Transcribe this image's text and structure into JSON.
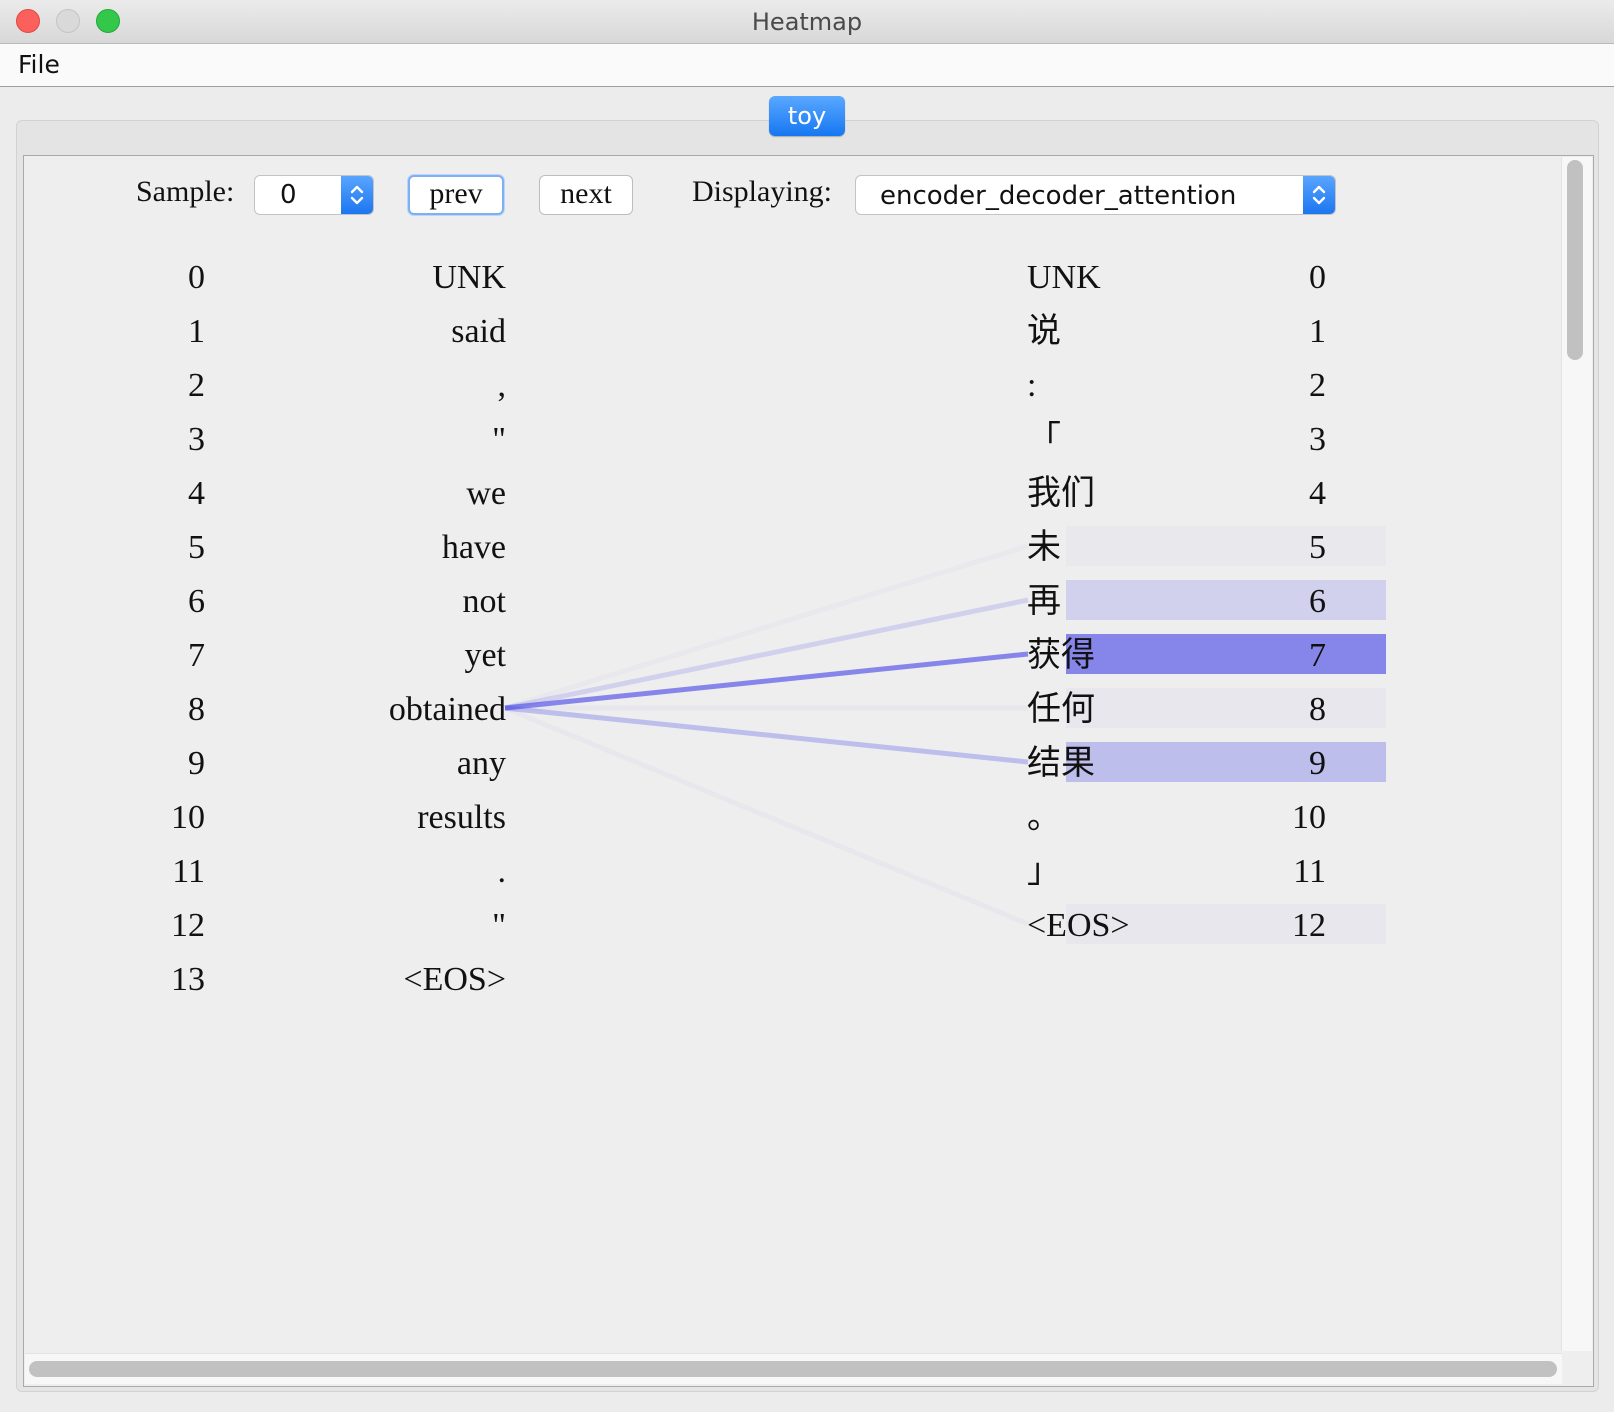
{
  "window": {
    "title": "Heatmap"
  },
  "menu": {
    "file": "File"
  },
  "tabs": [
    {
      "label": "toy",
      "selected": true
    }
  ],
  "controls": {
    "sample_label": "Sample:",
    "sample_value": "0",
    "prev_label": "prev",
    "next_label": "next",
    "displaying_label": "Displaying:",
    "displaying_value": "encoder_decoder_attention"
  },
  "colors": {
    "attention": "#4f4fe8",
    "window_bg": "#eeeeee",
    "tab_selected": "#1677f2"
  },
  "heatmap": {
    "source_tokens": [
      "UNK",
      "said",
      ",",
      "\"",
      "we",
      "have",
      "not",
      "yet",
      "obtained",
      "any",
      "results",
      ".",
      "\"",
      "<EOS>"
    ],
    "target_tokens": [
      "UNK",
      "说",
      ":",
      "「",
      "我们",
      "未",
      "再",
      "获得",
      "任何",
      "结果",
      "。",
      "」",
      "<EOS>"
    ],
    "selected_source_index": 8,
    "attention_weights": [
      0.0,
      0.0,
      0.0,
      0.0,
      0.0,
      0.03,
      0.18,
      0.65,
      0.04,
      0.3,
      0.0,
      0.0,
      0.04
    ]
  }
}
